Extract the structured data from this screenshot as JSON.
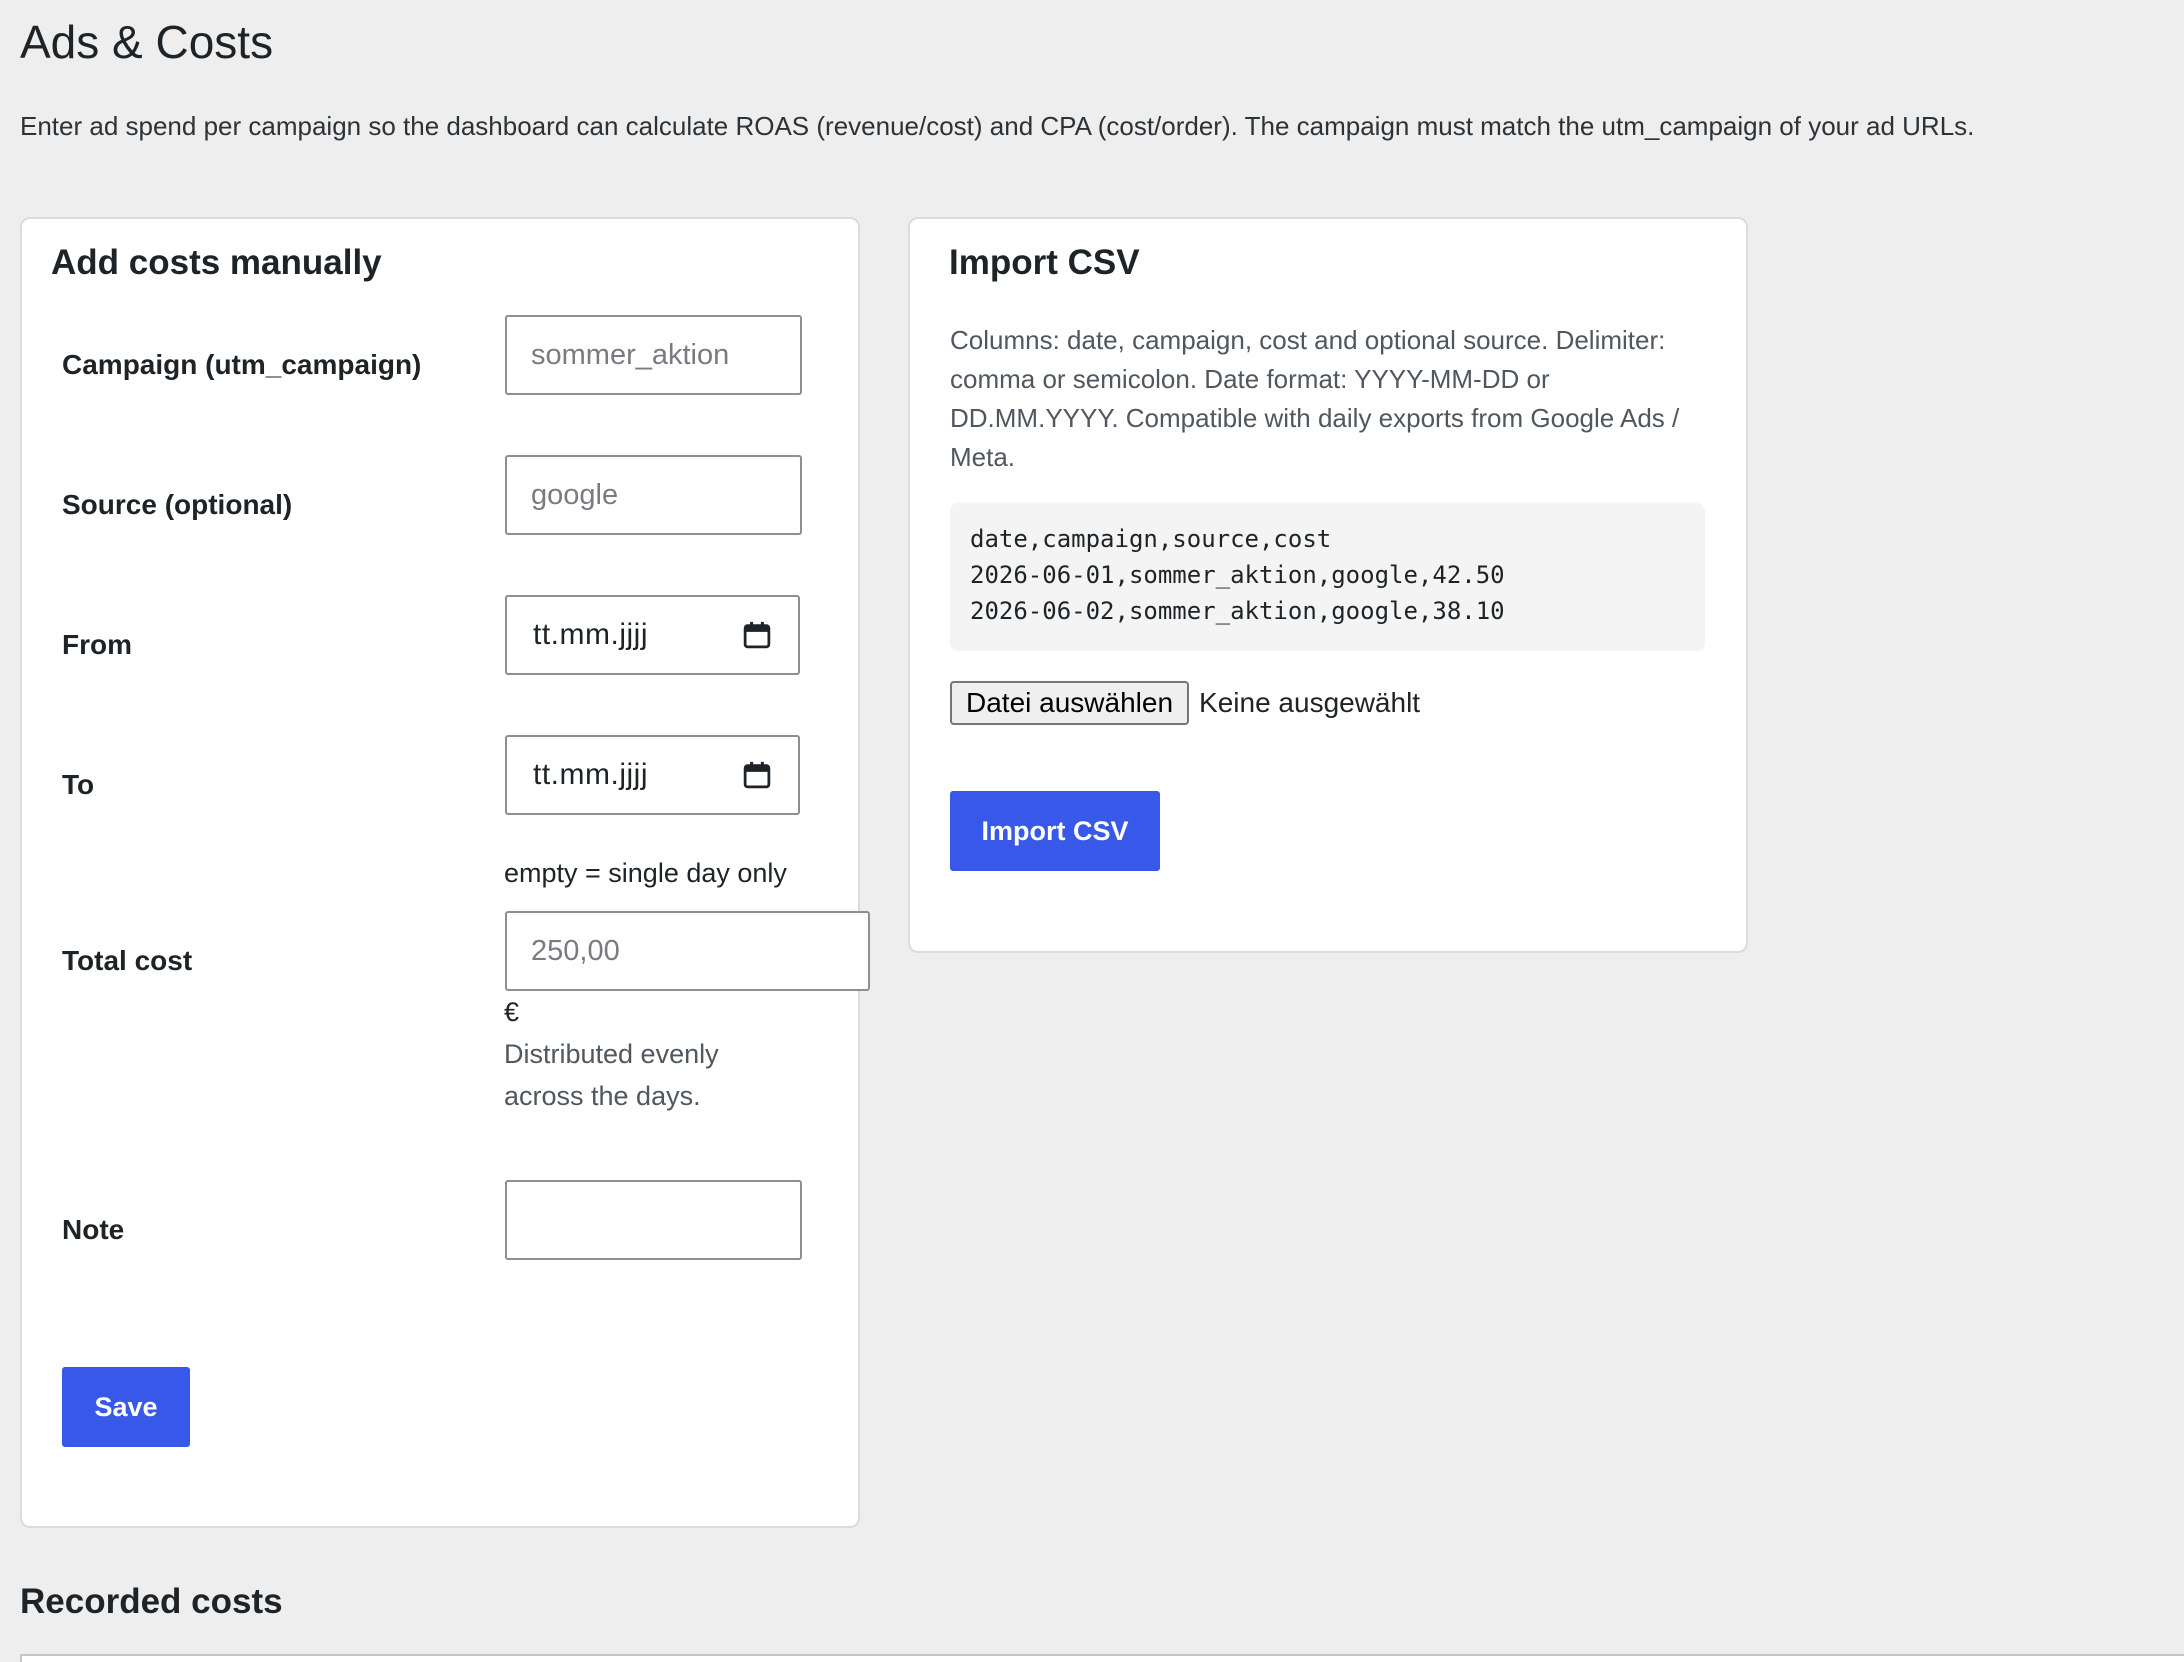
{
  "page": {
    "title": "Ads & Costs",
    "intro": "Enter ad spend per campaign so the dashboard can calculate ROAS (revenue/cost) and CPA (cost/order). The campaign must match the utm_campaign of your ad URLs."
  },
  "manual": {
    "title": "Add costs manually",
    "campaign": {
      "label": "Campaign (utm_campaign)",
      "value": "",
      "placeholder": "sommer_aktion"
    },
    "source": {
      "label": "Source (optional)",
      "value": "",
      "placeholder": "google"
    },
    "from": {
      "label": "From",
      "display": "tt.mm.jjjj",
      "icon": "calendar-icon"
    },
    "to": {
      "label": "To",
      "display": "tt.mm.jjjj",
      "icon": "calendar-icon",
      "hint": "empty = single day only"
    },
    "total_cost": {
      "label": "Total cost",
      "value": "",
      "placeholder": "250,00",
      "currency": "€",
      "hint": "Distributed evenly across the days."
    },
    "note": {
      "label": "Note",
      "value": "",
      "placeholder": ""
    },
    "save_label": "Save"
  },
  "import": {
    "title": "Import CSV",
    "description": "Columns: date, campaign, cost and optional source. Delimiter: comma or semicolon. Date format: YYYY-MM-DD or DD.MM.YYYY. Compatible with daily exports from Google Ads / Meta.",
    "example_lines": [
      "date,campaign,source,cost",
      "2026-06-01,sommer_aktion,google,42.50",
      "2026-06-02,sommer_aktion,google,38.10"
    ],
    "file_button_label": "Datei auswählen",
    "file_status": "Keine ausgewählt",
    "submit_label": "Import CSV"
  },
  "recorded": {
    "title": "Recorded costs"
  },
  "colors": {
    "background": "#eeeeee",
    "card": "#ffffff",
    "primary": "#3858e9",
    "code_background": "#f3f4f3"
  }
}
